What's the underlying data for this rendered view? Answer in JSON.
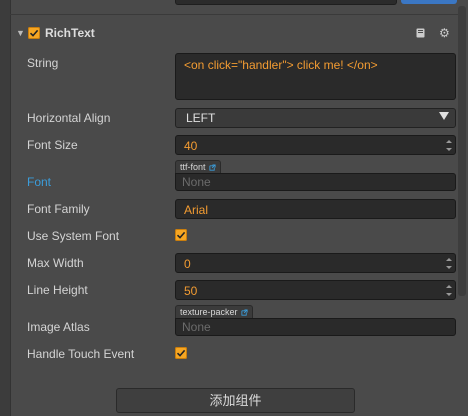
{
  "component": {
    "title": "RichText",
    "enabled": true
  },
  "props": {
    "string": {
      "label": "String",
      "value": "<on click=\"handler\"> click me! </on>"
    },
    "horizontal_align": {
      "label": "Horizontal Align",
      "value": "LEFT"
    },
    "font_size": {
      "label": "Font Size",
      "value": "40"
    },
    "font": {
      "label": "Font",
      "type_tag": "ttf-font",
      "placeholder": "None"
    },
    "font_family": {
      "label": "Font Family",
      "value": "Arial"
    },
    "use_system_font": {
      "label": "Use System Font",
      "checked": true
    },
    "max_width": {
      "label": "Max Width",
      "value": "0"
    },
    "line_height": {
      "label": "Line Height",
      "value": "50"
    },
    "image_atlas": {
      "label": "Image Atlas",
      "type_tag": "texture-packer",
      "placeholder": "None"
    },
    "handle_touch_event": {
      "label": "Handle Touch Event",
      "checked": true
    }
  },
  "add_component_button": "添加组件",
  "colors": {
    "accent_orange": "#f39c32",
    "checkbox": "#f6a623",
    "link_blue": "#3b9ddb",
    "panel_bg": "#4a4a4a"
  },
  "icons": [
    "collapse-arrow-icon",
    "checkmark-icon",
    "book-icon",
    "gear-icon",
    "external-link-icon",
    "caret-down-icon",
    "spinner-up-icon",
    "spinner-down-icon"
  ]
}
